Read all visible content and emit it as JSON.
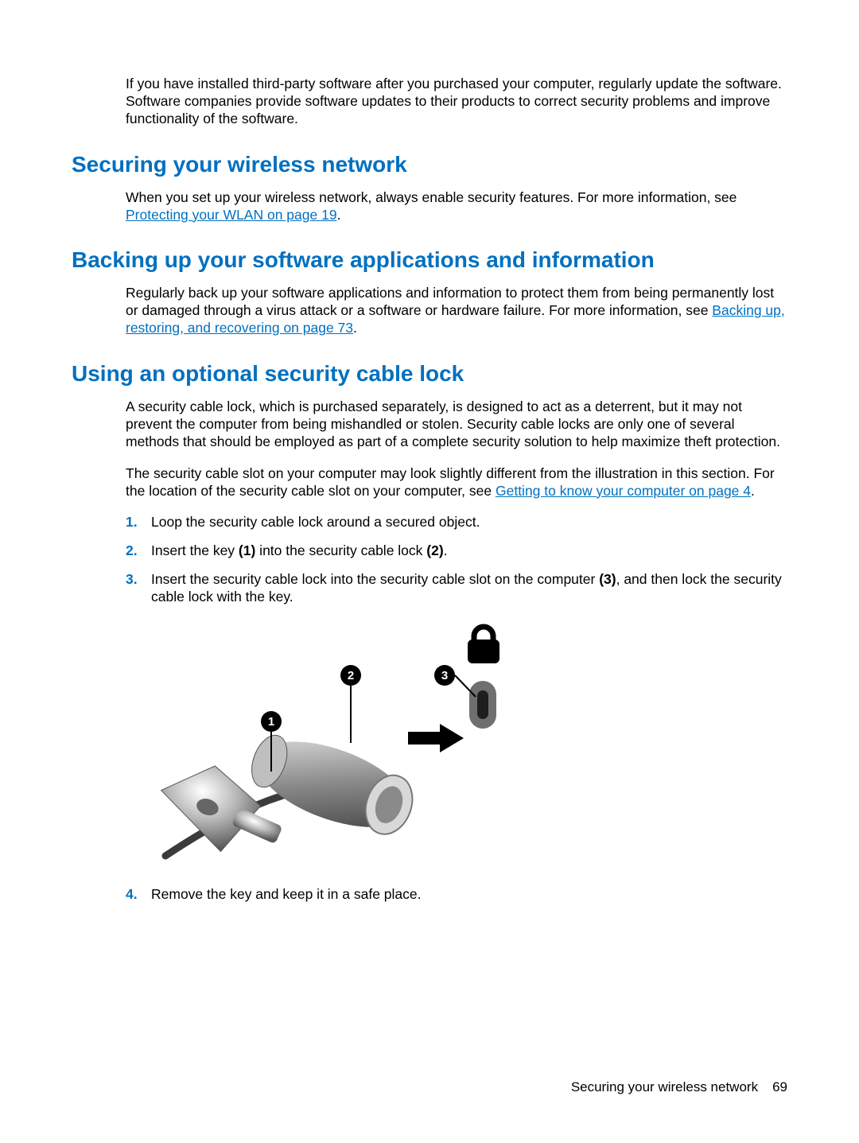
{
  "intro_para": "If you have installed third-party software after you purchased your computer, regularly update the software. Software companies provide software updates to their products to correct security problems and improve functionality of the software.",
  "sec1": {
    "heading": "Securing your wireless network",
    "para_pre": "When you set up your wireless network, always enable security features. For more information, see ",
    "link": "Protecting your WLAN on page 19",
    "para_post": "."
  },
  "sec2": {
    "heading": "Backing up your software applications and information",
    "para_pre": "Regularly back up your software applications and information to protect them from being permanently lost or damaged through a virus attack or a software or hardware failure. For more information, see ",
    "link": "Backing up, restoring, and recovering on page 73",
    "para_post": "."
  },
  "sec3": {
    "heading": "Using an optional security cable lock",
    "para1": "A security cable lock, which is purchased separately, is designed to act as a deterrent, but it may not prevent the computer from being mishandled or stolen. Security cable locks are only one of several methods that should be employed as part of a complete security solution to help maximize theft protection.",
    "para2_pre": "The security cable slot on your computer may look slightly different from the illustration in this section. For the location of the security cable slot on your computer, see ",
    "para2_link": "Getting to know your computer on page 4",
    "para2_post": ".",
    "step1": "Loop the security cable lock around a secured object.",
    "step2_a": "Insert the key ",
    "step2_b1": "(1)",
    "step2_c": " into the security cable lock ",
    "step2_b2": "(2)",
    "step2_d": ".",
    "step3_a": "Insert the security cable lock into the security cable slot on the computer ",
    "step3_b": "(3)",
    "step3_c": ", and then lock the security cable lock with the key.",
    "step4": "Remove the key and keep it in a safe place."
  },
  "callouts": {
    "c1": "1",
    "c2": "2",
    "c3": "3"
  },
  "footer": {
    "title": "Securing your wireless network",
    "page": "69"
  }
}
